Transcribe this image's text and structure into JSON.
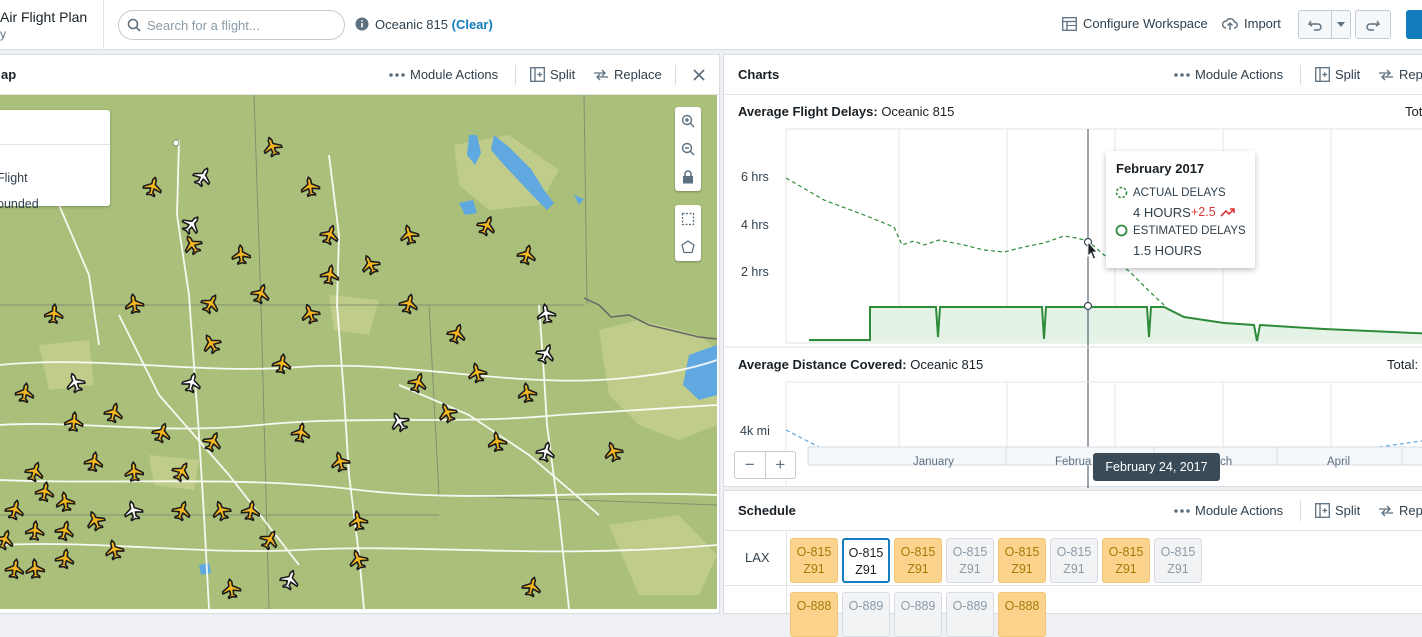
{
  "header": {
    "app_title": "Air Flight Plan",
    "app_subtitle": "y",
    "search_placeholder": "Search for a flight...",
    "flight_label": "Oceanic 815",
    "clear_label": "(Clear)",
    "configure_label": "Configure Workspace",
    "import_label": "Import"
  },
  "map_panel": {
    "title": "ap",
    "module_actions": "Module Actions",
    "split": "Split",
    "replace": "Replace",
    "legend": [
      "Flight",
      "ounded"
    ]
  },
  "charts_panel": {
    "title": "Charts",
    "module_actions": "Module Actions",
    "split": "Split",
    "replace": "Repl",
    "delays_label": "Average Flight Delays:",
    "delays_flight": "Oceanic 815",
    "delays_total": "Tot",
    "distance_label": "Average Distance Covered:",
    "distance_flight": "Oceanic 815",
    "distance_total": "Total:",
    "y_ticks": [
      "6 hrs",
      "4 hrs",
      "2 hrs"
    ],
    "distance_tick": "4k mi",
    "months": [
      "January",
      "Februa",
      "ch",
      "April"
    ],
    "date_tooltip": "February 24, 2017",
    "tooltip": {
      "title": "February 2017",
      "actual_label": "ACTUAL DELAYS",
      "actual_value": "4 HOURS",
      "actual_change": "+2.5",
      "estimated_label": "ESTIMATED DELAYS",
      "estimated_value": "1.5 HOURS"
    }
  },
  "schedule_panel": {
    "title": "Schedule",
    "module_actions": "Module Actions",
    "split": "Split",
    "replace": "Repl",
    "rows": [
      {
        "label": "LAX",
        "chips": [
          {
            "a": "O-815",
            "b": "Z91",
            "style": "y"
          },
          {
            "a": "O-815",
            "b": "Z91",
            "style": "sel"
          },
          {
            "a": "O-815",
            "b": "Z91",
            "style": "y"
          },
          {
            "a": "O-815",
            "b": "Z91",
            "style": "g"
          },
          {
            "a": "O-815",
            "b": "Z91",
            "style": "y"
          },
          {
            "a": "O-815",
            "b": "Z91",
            "style": "g"
          },
          {
            "a": "O-815",
            "b": "Z91",
            "style": "y"
          },
          {
            "a": "O-815",
            "b": "Z91",
            "style": "g"
          }
        ]
      },
      {
        "label": "",
        "chips": [
          {
            "a": "O-888",
            "b": "",
            "style": "y"
          },
          {
            "a": "O-889",
            "b": "",
            "style": "g"
          },
          {
            "a": "O-889",
            "b": "",
            "style": "g"
          },
          {
            "a": "O-889",
            "b": "",
            "style": "g"
          },
          {
            "a": "O-888",
            "b": "",
            "style": "y"
          }
        ]
      }
    ]
  },
  "colors": {
    "accent": "#137cbd",
    "map_land": "#aac07a",
    "water": "#5fa8e0",
    "plane_active": "#f6b820",
    "chart_green": "#2e8b3a",
    "trend_red": "#db3737"
  }
}
